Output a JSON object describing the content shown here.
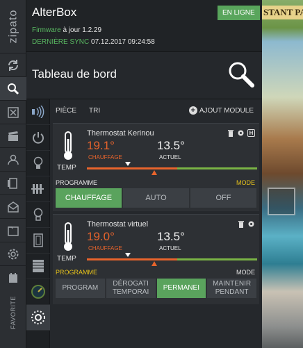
{
  "app": {
    "title": "AlterBox",
    "status_badge": "EN LIGNE"
  },
  "sidebar": {
    "logo": "zipato",
    "favorite_label": "FAVORITE"
  },
  "header": {
    "firmware_label": "Firmware",
    "firmware_value": "à jour 1.2.29",
    "sync_label": "DERNIÈRE SYNC",
    "sync_value": "07.12.2017 09:24:58"
  },
  "dashboard": {
    "title": "Tableau de bord"
  },
  "toolbar": {
    "room": "PIÈCE",
    "sort": "TRI",
    "add_module": "AJOUT MODULE"
  },
  "thermostats": [
    {
      "name": "Thermostat Kerinou",
      "setpoint": "19.1°",
      "mode_label": "CHAUFFAGE",
      "actual": "13.5°",
      "actual_label": "ACTUEL",
      "temp_label": "TEMP",
      "program_label": "PROGRAMME",
      "mode_tag": "MODE",
      "buttons": [
        "CHAUFFAGE",
        "AUTO",
        "OFF"
      ],
      "active_button": 0
    },
    {
      "name": "Thermostat virtuel",
      "setpoint": "19.0°",
      "mode_label": "CHAUFFAGE",
      "actual": "13.5°",
      "actual_label": "ACTUEL",
      "temp_label": "TEMP",
      "program_label": "PROGRAMME",
      "mode_tag": "MODE",
      "buttons": [
        "PROGRAM",
        "DÉROGATI TEMPORAI",
        "PERMANEI",
        "MAINTENIR PENDANT"
      ],
      "active_button": 2
    }
  ],
  "background": {
    "banner": "STANT PA"
  },
  "colors": {
    "accent_green": "#5aa35d",
    "heat_orange": "#e8642c",
    "label_yellow": "#e6c21b",
    "online_green": "#59a55c"
  }
}
